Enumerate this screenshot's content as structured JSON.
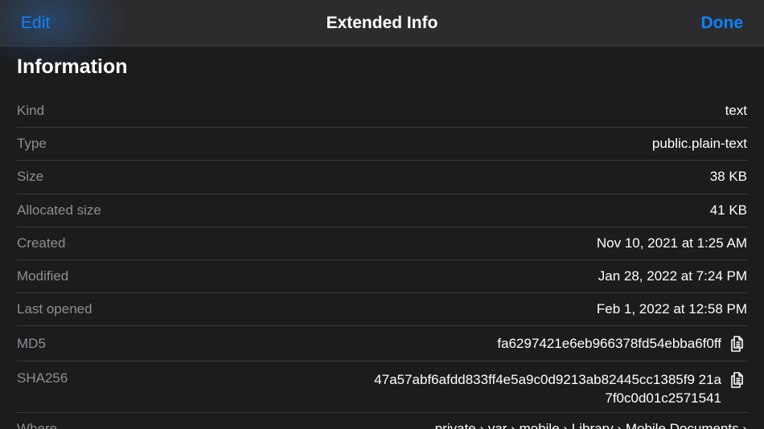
{
  "navbar": {
    "edit_label": "Edit",
    "title": "Extended Info",
    "done_label": "Done"
  },
  "section": {
    "title": "Information"
  },
  "rows": [
    {
      "label": "Kind",
      "value": "text"
    },
    {
      "label": "Type",
      "value": "public.plain-text"
    },
    {
      "label": "Size",
      "value": "38 KB"
    },
    {
      "label": "Allocated size",
      "value": "41 KB"
    },
    {
      "label": "Created",
      "value": "Nov 10, 2021 at 1:25 AM"
    },
    {
      "label": "Modified",
      "value": "Jan 28, 2022 at 7:24 PM"
    },
    {
      "label": "Last opened",
      "value": "Feb 1, 2022 at 12:58 PM"
    },
    {
      "label": "MD5",
      "value": "fa6297421e6eb966378fd54ebba6f0ff"
    },
    {
      "label": "SHA256",
      "value": "47a57abf6afdd833ff4e5a9c0d9213ab82445cc1385f9 21a7f0c0d01c2571541"
    },
    {
      "label": "Where",
      "value": "private › var › mobile › Library › Mobile Documents ›"
    }
  ],
  "colors": {
    "accent": "#0a84ff",
    "background": "#1c1c1e",
    "navbar": "#2c2c2e",
    "secondary_text": "#8e8e93",
    "separator": "#3a3a3c"
  },
  "icons": {
    "copy": "copy-icon"
  }
}
